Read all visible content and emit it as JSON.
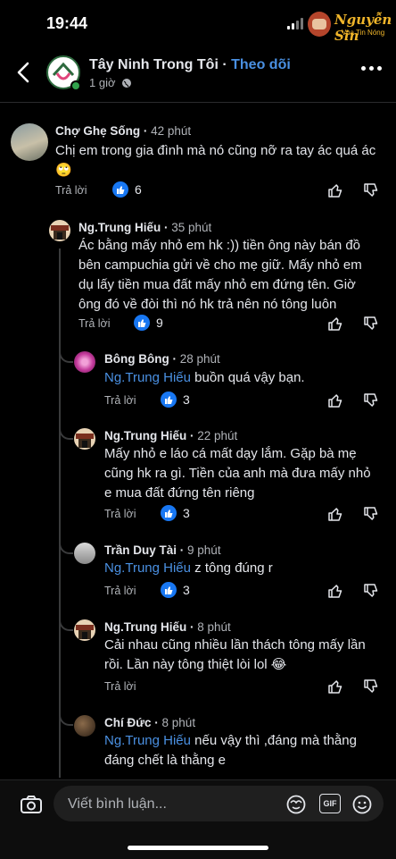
{
  "status": {
    "time": "19:44"
  },
  "watermark": {
    "line1": "Nguyễn Sin",
    "line2": "Vua Tin Nóng"
  },
  "header": {
    "page_name": "Tây Ninh Trong Tôi",
    "separator": "·",
    "follow_label": "Theo dõi",
    "meta_time": "1 giờ"
  },
  "comments": [
    {
      "author": "Chợ Ghẹ Sống",
      "ago": "42 phút",
      "text": "Chị em trong gia đình mà nó cũng nỡ ra tay ác quá ác🙄",
      "reply_label": "Trả lời",
      "likes": "6"
    },
    {
      "author": "Ng.Trung Hiếu",
      "ago": "35 phút",
      "text": "Ác bằng mấy nhỏ em hk :)) tiền ông này bán đồ bên campuchia gửi về cho mẹ giữ. Mấy nhỏ em dụ lấy tiền mua đất mấy nhỏ em đứng tên. Giờ ông đó về đòi thì nó hk trả nên nó tông luôn",
      "reply_label": "Trả lời",
      "likes": "9"
    },
    {
      "author": "Bông Bông",
      "ago": "28 phút",
      "mention": "Ng.Trung Hiếu",
      "text": " buồn quá vậy bạn.",
      "reply_label": "Trả lời",
      "likes": "3"
    },
    {
      "author": "Ng.Trung Hiếu",
      "ago": "22 phút",
      "text": "Mấy nhỏ e láo cá mất dạy lắm. Gặp bà mẹ cũng hk ra gì. Tiền của anh mà đưa mấy nhỏ e mua đất đứng tên riêng",
      "reply_label": "Trả lời",
      "likes": "3"
    },
    {
      "author": "Trần Duy Tài",
      "ago": "9 phút",
      "mention": "Ng.Trung Hiếu",
      "text": "  z tông đúng r",
      "reply_label": "Trả lời",
      "likes": "3"
    },
    {
      "author": "Ng.Trung Hiếu",
      "ago": "8 phút",
      "text": "Cải nhau cũng nhiều lần thách tông mấy lần rồi. Lần này tông thiệt lòi lol 😂",
      "reply_label": "Trả lời"
    },
    {
      "author": "Chí Đức",
      "ago": "8 phút",
      "mention": "Ng.Trung Hiếu",
      "text": " nếu vậy thì ,đáng mà thằng đáng chết là thằng e"
    }
  ],
  "composer": {
    "placeholder": "Viết bình luận...",
    "gif_label": "GIF"
  },
  "icons": {
    "back": "chevron-left-icon",
    "more": "more-icon",
    "globe": "globe-icon",
    "like": "like-icon",
    "dislike": "dislike-icon",
    "camera": "camera-icon",
    "avatar_sticker": "avatar-sticker-icon",
    "gif": "gif-icon",
    "emoji": "emoji-icon"
  },
  "colors": {
    "accent": "#4a90e2",
    "like_blue": "#1877f2",
    "online": "#31a24c"
  }
}
